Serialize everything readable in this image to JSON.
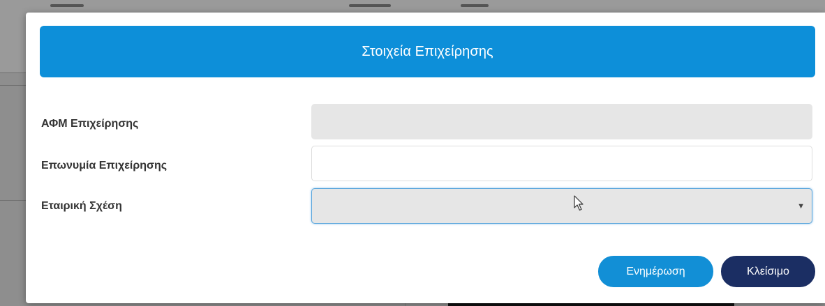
{
  "modal": {
    "title": "Στοιχεία Επιχείρησης"
  },
  "form": {
    "afm": {
      "label": "ΑΦΜ Επιχείρησης",
      "value": ""
    },
    "name": {
      "label": "Επωνυμία Επιχείρησης",
      "value": ""
    },
    "relation": {
      "label": "Εταιρική Σχέση",
      "selected": ""
    }
  },
  "buttons": {
    "update_label": "Ενημέρωση",
    "close_label": "Κλείσιμο"
  },
  "colors": {
    "header": "#0d8fd9",
    "update_button": "#128fd6",
    "close_button": "#1b2e63",
    "disabled_field": "#e6e6e6"
  },
  "icons": {
    "select_caret": "dropdown-caret-icon",
    "mouse_pointer": "mouse-pointer-icon"
  }
}
